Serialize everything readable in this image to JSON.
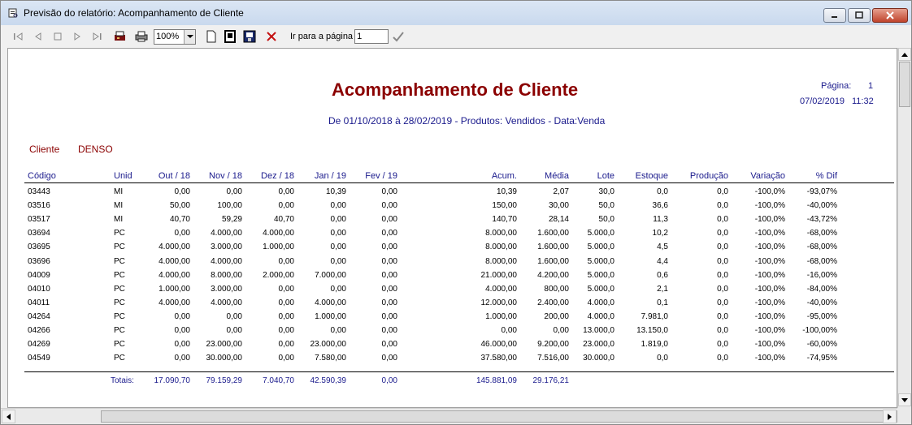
{
  "window": {
    "title": "Previsão do relatório: Acompanhamento de Cliente"
  },
  "toolbar": {
    "zoom_value": "100%",
    "goto_label": "Ir para a página",
    "goto_value": "1"
  },
  "report": {
    "title": "Acompanhamento de Cliente",
    "subtitle": "De 01/10/2018 à 28/02/2019 - Produtos: Vendidos - Data:Venda",
    "page_label": "Página:",
    "page_number": "1",
    "date": "07/02/2019",
    "time": "11:32",
    "client_label": "Cliente",
    "client_value": "DENSO",
    "columns": [
      "Código",
      "Unid",
      "Out / 18",
      "Nov / 18",
      "Dez / 18",
      "Jan / 19",
      "Fev / 19",
      "Acum.",
      "Média",
      "Lote",
      "Estoque",
      "Produção",
      "Variação",
      "% Dif"
    ],
    "rows": [
      [
        "03443",
        "MI",
        "0,00",
        "0,00",
        "0,00",
        "10,39",
        "0,00",
        "10,39",
        "2,07",
        "30,0",
        "0,0",
        "0,0",
        "-100,0%",
        "-93,07%"
      ],
      [
        "03516",
        "MI",
        "50,00",
        "100,00",
        "0,00",
        "0,00",
        "0,00",
        "150,00",
        "30,00",
        "50,0",
        "36,6",
        "0,0",
        "-100,0%",
        "-40,00%"
      ],
      [
        "03517",
        "MI",
        "40,70",
        "59,29",
        "40,70",
        "0,00",
        "0,00",
        "140,70",
        "28,14",
        "50,0",
        "11,3",
        "0,0",
        "-100,0%",
        "-43,72%"
      ],
      [
        "03694",
        "PC",
        "0,00",
        "4.000,00",
        "4.000,00",
        "0,00",
        "0,00",
        "8.000,00",
        "1.600,00",
        "5.000,0",
        "10,2",
        "0,0",
        "-100,0%",
        "-68,00%"
      ],
      [
        "03695",
        "PC",
        "4.000,00",
        "3.000,00",
        "1.000,00",
        "0,00",
        "0,00",
        "8.000,00",
        "1.600,00",
        "5.000,0",
        "4,5",
        "0,0",
        "-100,0%",
        "-68,00%"
      ],
      [
        "03696",
        "PC",
        "4.000,00",
        "4.000,00",
        "0,00",
        "0,00",
        "0,00",
        "8.000,00",
        "1.600,00",
        "5.000,0",
        "4,4",
        "0,0",
        "-100,0%",
        "-68,00%"
      ],
      [
        "04009",
        "PC",
        "4.000,00",
        "8.000,00",
        "2.000,00",
        "7.000,00",
        "0,00",
        "21.000,00",
        "4.200,00",
        "5.000,0",
        "0,6",
        "0,0",
        "-100,0%",
        "-16,00%"
      ],
      [
        "04010",
        "PC",
        "1.000,00",
        "3.000,00",
        "0,00",
        "0,00",
        "0,00",
        "4.000,00",
        "800,00",
        "5.000,0",
        "2,1",
        "0,0",
        "-100,0%",
        "-84,00%"
      ],
      [
        "04011",
        "PC",
        "4.000,00",
        "4.000,00",
        "0,00",
        "4.000,00",
        "0,00",
        "12.000,00",
        "2.400,00",
        "4.000,0",
        "0,1",
        "0,0",
        "-100,0%",
        "-40,00%"
      ],
      [
        "04264",
        "PC",
        "0,00",
        "0,00",
        "0,00",
        "1.000,00",
        "0,00",
        "1.000,00",
        "200,00",
        "4.000,0",
        "7.981,0",
        "0,0",
        "-100,0%",
        "-95,00%"
      ],
      [
        "04266",
        "PC",
        "0,00",
        "0,00",
        "0,00",
        "0,00",
        "0,00",
        "0,00",
        "0,00",
        "13.000,0",
        "13.150,0",
        "0,0",
        "-100,0%",
        "-100,00%"
      ],
      [
        "04269",
        "PC",
        "0,00",
        "23.000,00",
        "0,00",
        "23.000,00",
        "0,00",
        "46.000,00",
        "9.200,00",
        "23.000,0",
        "1.819,0",
        "0,0",
        "-100,0%",
        "-60,00%"
      ],
      [
        "04549",
        "PC",
        "0,00",
        "30.000,00",
        "0,00",
        "7.580,00",
        "0,00",
        "37.580,00",
        "7.516,00",
        "30.000,0",
        "0,0",
        "0,0",
        "-100,0%",
        "-74,95%"
      ]
    ],
    "totals_label": "Totais:",
    "totals": [
      "17.090,70",
      "79.159,29",
      "7.040,70",
      "42.590,39",
      "0,00",
      "145.881,09",
      "29.176,21"
    ]
  },
  "colors": {
    "title": "#8b0000",
    "header_text": "#1a1a8c"
  }
}
